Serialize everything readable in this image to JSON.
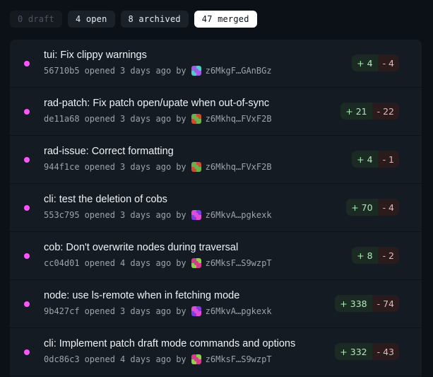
{
  "filters": [
    {
      "label": "0 draft",
      "state": "disabled"
    },
    {
      "label": "4 open",
      "state": "normal"
    },
    {
      "label": "8 archived",
      "state": "normal"
    },
    {
      "label": "47 merged",
      "state": "active"
    }
  ],
  "patches": [
    {
      "title": "tui: Fix clippy warnings",
      "id": "56710b5",
      "opened": "opened",
      "age": "3 days ago",
      "by": "by",
      "author": "z6MkgF…GAnBGz",
      "added": "+ 4",
      "removed": "- 4",
      "avatar_colors": [
        "#4ad0c9",
        "#a05ce6"
      ]
    },
    {
      "title": "rad-patch: Fix patch open/upate when out-of-sync",
      "id": "de11a68",
      "opened": "opened",
      "age": "3 days ago",
      "by": "by",
      "author": "z6Mkhq…FVxF2B",
      "added": "+ 21",
      "removed": "- 22",
      "avatar_colors": [
        "#d44a2a",
        "#6ab04c"
      ]
    },
    {
      "title": "rad-issue: Correct formatting",
      "id": "944f1ce",
      "opened": "opened",
      "age": "3 days ago",
      "by": "by",
      "author": "z6Mkhq…FVxF2B",
      "added": "+ 4",
      "removed": "- 1",
      "avatar_colors": [
        "#d44a2a",
        "#6ab04c"
      ]
    },
    {
      "title": "cli: test the deletion of cobs",
      "id": "553c795",
      "opened": "opened",
      "age": "3 days ago",
      "by": "by",
      "author": "z6MkvA…pgkexk",
      "added": "+ 70",
      "removed": "- 4",
      "avatar_colors": [
        "#7b3fe4",
        "#e14bd6"
      ]
    },
    {
      "title": "cob: Don't overwrite nodes during traversal",
      "id": "cc04d01",
      "opened": "opened",
      "age": "4 days ago",
      "by": "by",
      "author": "z6MksF…S9wzpT",
      "added": "+ 8",
      "removed": "- 2",
      "avatar_colors": [
        "#8dd14a",
        "#d43c8c"
      ]
    },
    {
      "title": "node: use ls-remote when in fetching mode",
      "id": "9b427cf",
      "opened": "opened",
      "age": "3 days ago",
      "by": "by",
      "author": "z6MkvA…pgkexk",
      "added": "+ 338",
      "removed": "- 74",
      "avatar_colors": [
        "#7b3fe4",
        "#e14bd6"
      ]
    },
    {
      "title": "cli: Implement patch draft mode commands and options",
      "id": "0dc86c3",
      "opened": "opened",
      "age": "4 days ago",
      "by": "by",
      "author": "z6MksF…S9wzpT",
      "added": "+ 332",
      "removed": "- 43",
      "avatar_colors": [
        "#8dd14a",
        "#d43c8c"
      ]
    }
  ]
}
